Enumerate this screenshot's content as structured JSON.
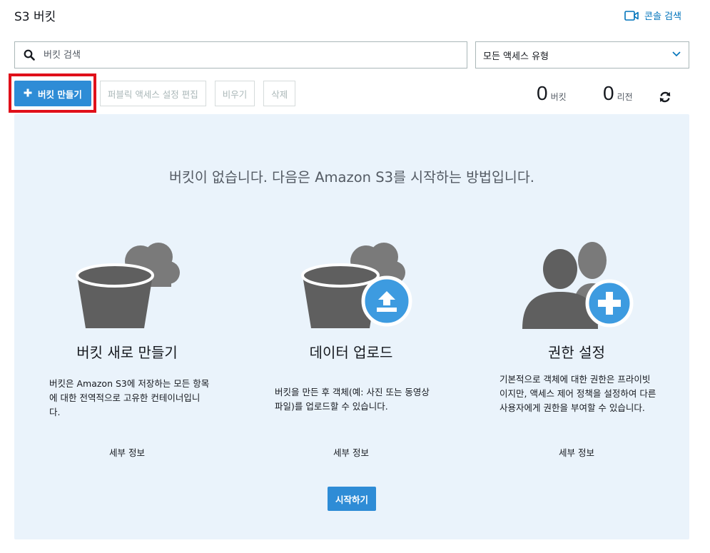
{
  "header": {
    "title": "S3 버킷",
    "console_search_label": "콘솔 검색",
    "console_search_icon": "video-camera-icon"
  },
  "search": {
    "placeholder": "버킷 검색",
    "icon": "search-icon"
  },
  "access_filter": {
    "selected": "모든 액세스 유형",
    "icon": "chevron-down-icon"
  },
  "toolbar": {
    "create_label": "버킷 만들기",
    "edit_public_label": "퍼블릭 액세스 설정 편집",
    "empty_label": "비우기",
    "delete_label": "삭제"
  },
  "counts": {
    "buckets_value": "0",
    "buckets_label": "버킷",
    "regions_value": "0",
    "regions_label": "리전"
  },
  "panel": {
    "heading": "버킷이 없습니다. 다음은 Amazon S3를 시작하는 방법입니다.",
    "columns": [
      {
        "title": "버킷 새로 만들기",
        "description": "버킷은 Amazon S3에 저장하는 모든 항목에 대한 전역적으로 고유한 컨테이너입니다.",
        "link": "세부 정보",
        "icon": "bucket-cloud-icon"
      },
      {
        "title": "데이터 업로드",
        "description": "버킷을 만든 후 객체(예: 사진 또는 동영상 파일)를 업로드할 수 있습니다.",
        "link": "세부 정보",
        "icon": "bucket-upload-icon"
      },
      {
        "title": "권한 설정",
        "description": "기본적으로 객체에 대한 권한은 프라이빗이지만, 액세스 제어 정책을 설정하여 다른 사용자에게 권한을 부여할 수 있습니다.",
        "link": "세부 정보",
        "icon": "users-add-icon"
      }
    ],
    "start_label": "시작하기"
  },
  "colors": {
    "primary": "#2e8cd6",
    "panel_bg": "#eaf3fb",
    "highlight": "#e0101a",
    "icon_gray": "#666666"
  }
}
